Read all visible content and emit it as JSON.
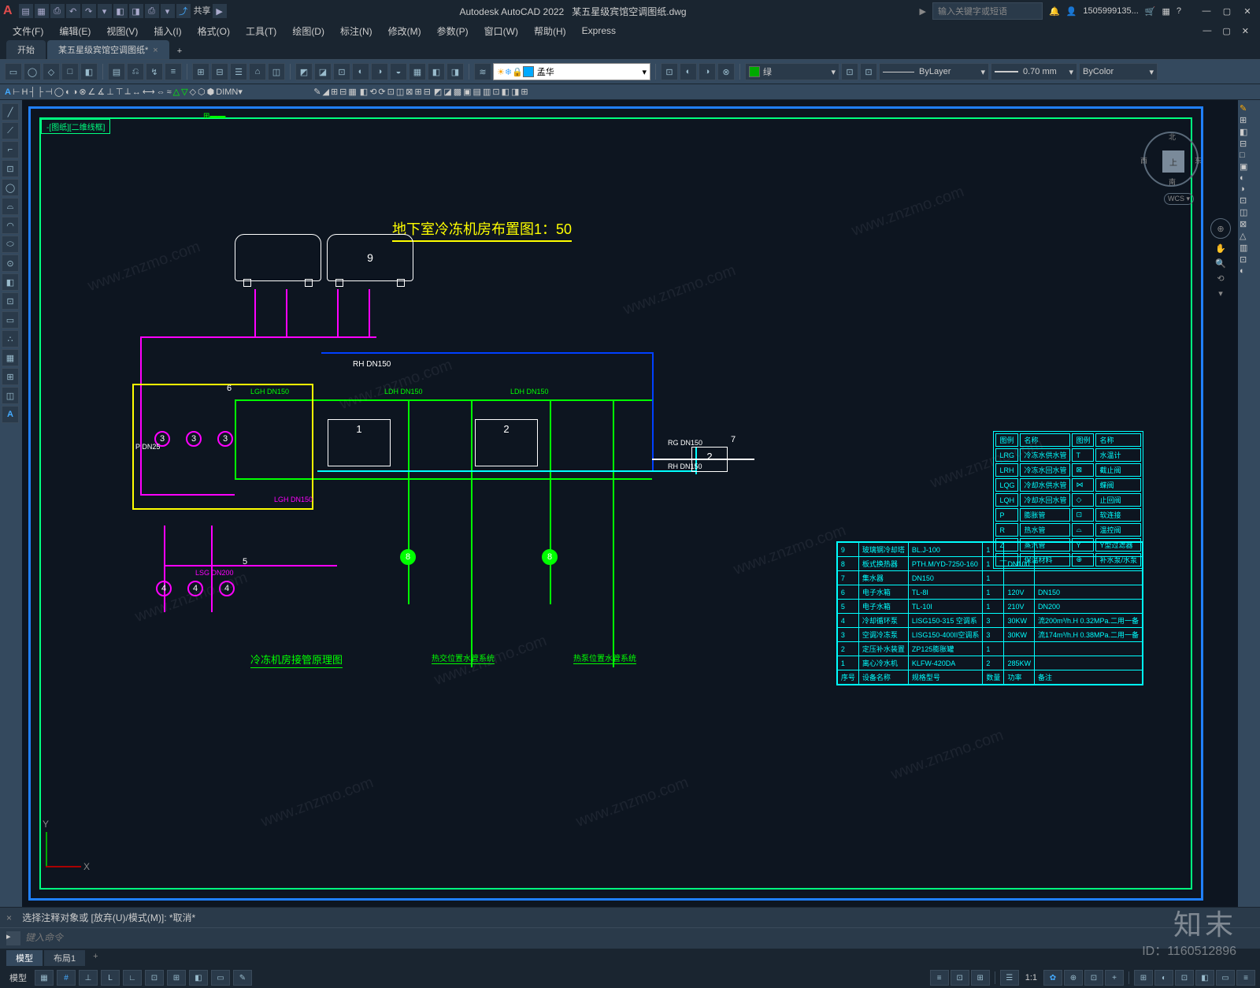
{
  "app": {
    "logo_letter": "A",
    "share": "共享",
    "product": "Autodesk AutoCAD 2022",
    "filename": "某五星级宾馆空调图纸.dwg",
    "search_placeholder": "输入关键字或短语",
    "user": "1505999135...",
    "win_min": "—",
    "win_max": "▢",
    "win_close": "✕"
  },
  "qat": [
    "▤",
    "▦",
    "⎙",
    "↶",
    "↷",
    "▾",
    "◧",
    "◨",
    "⎙",
    "▾",
    "▶"
  ],
  "menus": [
    "文件(F)",
    "编辑(E)",
    "视图(V)",
    "插入(I)",
    "格式(O)",
    "工具(T)",
    "绘图(D)",
    "标注(N)",
    "修改(M)",
    "参数(P)",
    "窗口(W)",
    "帮助(H)",
    "Express"
  ],
  "filetabs": {
    "start": "开始",
    "doc": "某五星级宾馆空调图纸*",
    "close": "×",
    "add": "+"
  },
  "ribbon1": {
    "icons": [
      "▭",
      "◯",
      "◇",
      "□",
      "◧",
      "▤",
      "⎌",
      "↯",
      "≡",
      "⊞",
      "⊟",
      "☰",
      "⌂",
      "◫",
      "◩",
      "◪",
      "⊡",
      "◐",
      "◑",
      "◒",
      "▦",
      "◧",
      "◨"
    ],
    "layer_icons": [
      "☀",
      "❄",
      "🔒",
      "▭"
    ],
    "layer_name": "孟华",
    "color_swatch": "#00aa00",
    "color_name": "绿",
    "linetype": "ByLayer",
    "lineweight": "0.70 mm",
    "plotstyle": "ByColor"
  },
  "ribbon2": {
    "icons_a": [
      "A",
      "⊢",
      "H",
      "┤",
      "├",
      "⊣",
      "◯",
      "◐",
      "◑",
      "⊗",
      "∠",
      "∡",
      "⊥",
      "⊤",
      "⟂",
      "↔",
      "⟷",
      "⇔",
      "≈",
      "△",
      "▽",
      "◇",
      "⬡",
      "⬢"
    ],
    "dimstyle": "DIMN",
    "icons_b": [
      "✎",
      "◢",
      "⊞",
      "⊟",
      "▦",
      "◧",
      "⟲",
      "⟳",
      "⊡",
      "◫",
      "⊠",
      "⊞",
      "⊟",
      "◩",
      "◪",
      "▩",
      "▣",
      "▤",
      "▥",
      "⊡",
      "◧",
      "◨",
      "⊞"
    ]
  },
  "left_tools": [
    "╱",
    "⟋",
    "⌐",
    "⊡",
    "◯",
    "⌓",
    "◠",
    "⬭",
    "⊙",
    "◧",
    "⊡",
    "▭",
    "∴",
    "▦",
    "⊞",
    "◫",
    "A"
  ],
  "right_tools": [
    "✎",
    "⊞",
    "◧",
    "⊟",
    "□",
    "▣",
    "◐",
    "◑",
    "⊡",
    "◫",
    "⊠",
    "△",
    "▥",
    "⊡",
    "◐"
  ],
  "drawing": {
    "tab_label": "-[图纸][二维线框]",
    "main_title": "地下室冷冻机房布置图1：50",
    "tank_label": "9",
    "pipe_rh": "RH DN150",
    "pipe_lgh1": "LGH DN150",
    "pipe_lgh2": "LGH DN150",
    "pipe_ldh": "LDH DN150",
    "pipe_rg": "RG DN150",
    "pipe_lsg": "LSG DN200",
    "pump_label_p": "P DN25",
    "sub_title1": "冷冻机房接管原理图",
    "sub_text1": "热交位置水管系统",
    "sub_text2": "热泵位置水管系统",
    "node1": "1",
    "node2": "2",
    "node3": "3",
    "node4": "4",
    "node5": "5",
    "node6": "6",
    "node7": "7",
    "node8": "8"
  },
  "legend": {
    "h1": "图例",
    "h2": "名称",
    "h3": "图例",
    "h4": "名称",
    "r": [
      [
        "LRG",
        "冷冻水供水管",
        "T",
        "水温计"
      ],
      [
        "LRH",
        "冷冻水回水管",
        "⊠",
        "截止阀"
      ],
      [
        "LQG",
        "冷却水供水管",
        "⋈",
        "蝶阀"
      ],
      [
        "LQH",
        "冷却水回水管",
        "◇",
        "止回阀"
      ],
      [
        "P",
        "膨胀管",
        "⊡",
        "软连接"
      ],
      [
        "R",
        "热水管",
        "⌓",
        "温控阀"
      ],
      [
        "Z",
        "蒸汽管",
        "Y",
        "Y型过滤器"
      ],
      [
        "—",
        "保温材料",
        "⊕",
        "补水泵/水泵"
      ]
    ]
  },
  "equip": {
    "rows": [
      [
        "9",
        "玻璃钢冷却塔",
        "BL.J-100",
        "1",
        "",
        ""
      ],
      [
        "8",
        "板式换热器",
        "PTH.M/YD-7250-160",
        "1",
        "DN100",
        ""
      ],
      [
        "7",
        "集水器",
        "DN150",
        "1",
        "",
        ""
      ],
      [
        "6",
        "电子水箱",
        "TL-8I",
        "1",
        "120V",
        "DN150"
      ],
      [
        "5",
        "电子水箱",
        "TL-10I",
        "1",
        "210V",
        "DN200"
      ],
      [
        "4",
        "冷却循环泵",
        "LISG150-315 空调系",
        "3",
        "30KW",
        "流200m³/h.H 0.32MPa.二用一备"
      ],
      [
        "3",
        "空调冷冻泵",
        "LISG150-400II空调系",
        "3",
        "30KW",
        "流174m³/h.H 0.38MPa.二用一备"
      ],
      [
        "2",
        "定压补水装置",
        "ZP125膨胀罐",
        "1",
        "",
        ""
      ],
      [
        "1",
        "离心冷水机",
        "KLFW-420DA",
        "2",
        "285KW",
        ""
      ],
      [
        "序号",
        "设备名称",
        "规格型号",
        "数量",
        "功率",
        "备注"
      ]
    ]
  },
  "viewcube": {
    "top": "上",
    "n": "北",
    "s": "南",
    "e": "东",
    "w": "西",
    "wcs": "WCS ▾"
  },
  "ucs": {
    "x": "X",
    "y": "Y"
  },
  "cmd": {
    "history": "选择注释对象或 [放弃(U)/模式(M)]: *取消*",
    "placeholder": "键入命令"
  },
  "layouts": {
    "model": "模型",
    "layout1": "布局1",
    "add": "+"
  },
  "status": {
    "left_text": "模型",
    "icons": [
      "▦",
      "#",
      "⊥",
      "L",
      "∟",
      "⊡",
      "⊞",
      "◧",
      "▭",
      "✎",
      "≡",
      "⊡",
      "⊞",
      "☰",
      "1:1",
      "✿",
      "⊕",
      "⊡",
      "+",
      "⊞",
      "◐",
      "⊡",
      "◧",
      "▭",
      "≡"
    ]
  },
  "watermark": {
    "brand": "知末",
    "id": "ID：1160512896",
    "url": "www.znzmo.com"
  }
}
